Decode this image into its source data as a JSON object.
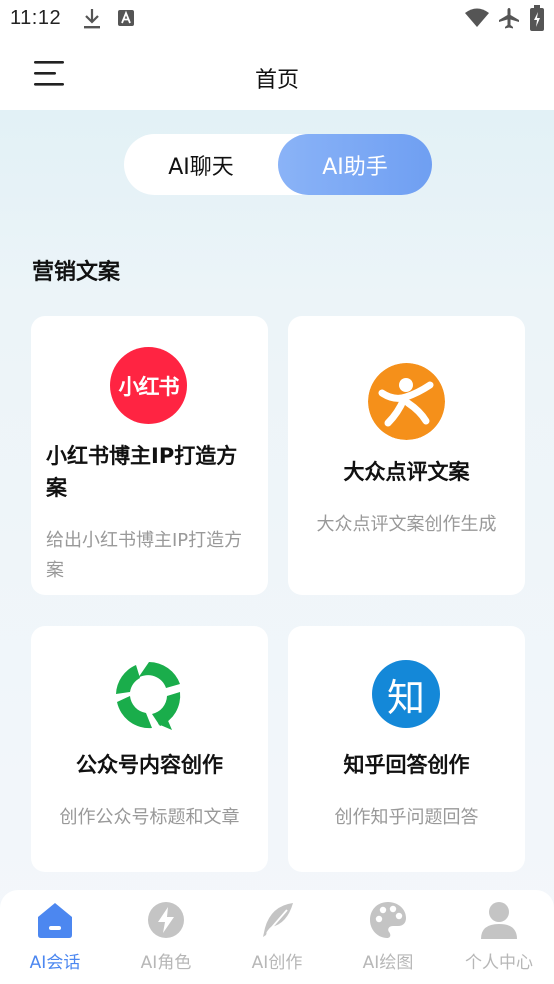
{
  "status_bar": {
    "time": "11:12",
    "icons": [
      "download-icon",
      "font-icon",
      "wifi-icon",
      "airplane-mode-icon",
      "battery-charging-icon"
    ]
  },
  "app_bar": {
    "title": "首页",
    "menu_icon": "menu-icon"
  },
  "mode_toggle": {
    "options": [
      "AI聊天",
      "AI助手"
    ],
    "selected": "AI助手",
    "active_color": "#7ba8f5"
  },
  "section": {
    "title": "营销文案"
  },
  "cards": [
    {
      "logo_text": "小红书",
      "logo_color": "#ff2442",
      "title": "小红书博主IP打造方案",
      "desc": "给出小红书博主IP打造方案"
    },
    {
      "logo_icon": "dianping-icon",
      "logo_color": "#f5901a",
      "title": "大众点评文案",
      "desc": "大众点评文案创作生成"
    },
    {
      "logo_icon": "wechat-official-account-icon",
      "logo_color": "#1aad4b",
      "title": "公众号内容创作",
      "desc": "创作公众号标题和文章"
    },
    {
      "logo_text": "知",
      "logo_color": "#1488d8",
      "title": "知乎回答创作",
      "desc": "创作知乎问题回答"
    }
  ],
  "tab_bar": {
    "items": [
      {
        "label": "AI会话",
        "icon": "home-icon",
        "active": true
      },
      {
        "label": "AI角色",
        "icon": "lightning-icon",
        "active": false
      },
      {
        "label": "AI创作",
        "icon": "feather-icon",
        "active": false
      },
      {
        "label": "AI绘图",
        "icon": "palette-icon",
        "active": false
      },
      {
        "label": "个人中心",
        "icon": "user-icon",
        "active": false
      }
    ],
    "active_color": "#4c87f0",
    "inactive_color": "#b7b7b7"
  }
}
